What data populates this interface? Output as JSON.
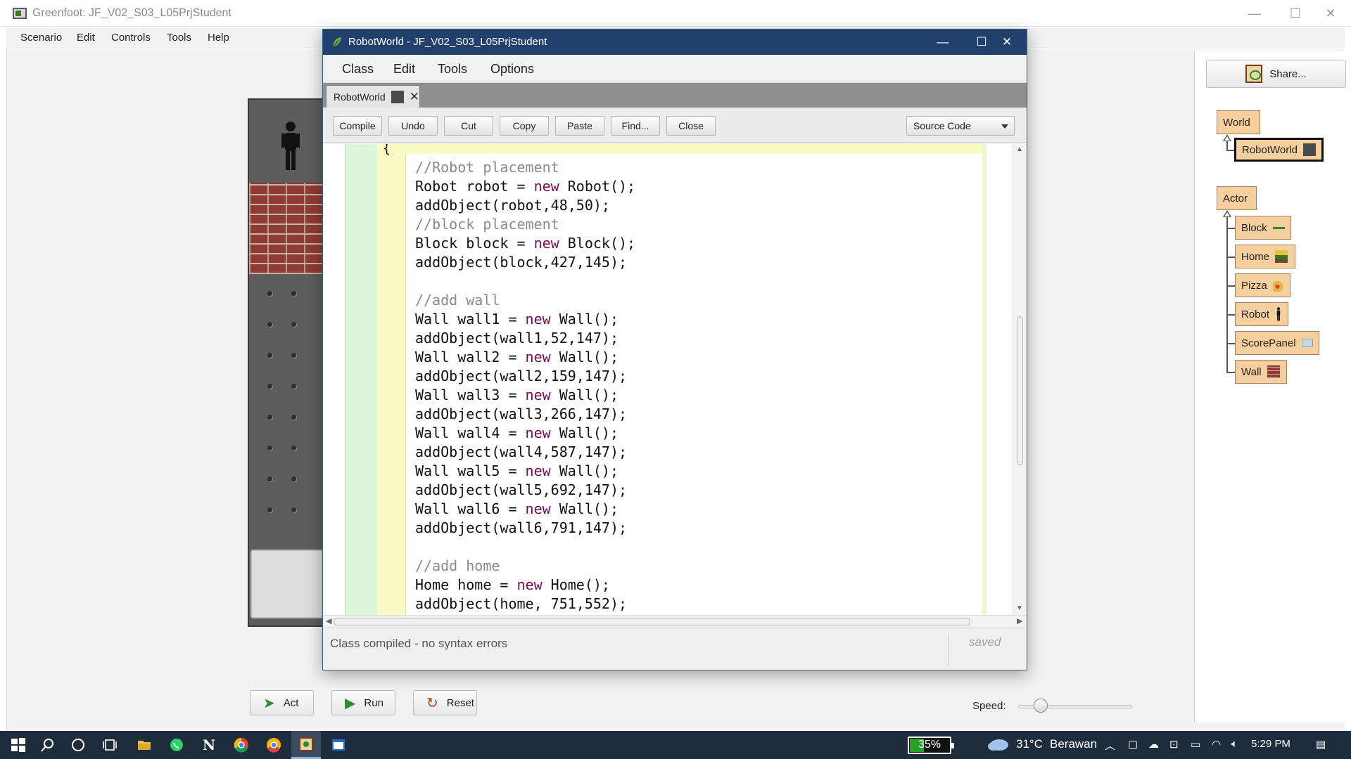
{
  "greenfoot": {
    "title": "Greenfoot: JF_V02_S03_L05PrjStudent",
    "menu": [
      "Scenario",
      "Edit",
      "Controls",
      "Tools",
      "Help"
    ],
    "controls": {
      "act": "Act",
      "run": "Run",
      "reset": "Reset",
      "speed_label": "Speed:",
      "speed_value": 0.2
    },
    "share_label": "Share...",
    "classes": {
      "world": "World",
      "robot_world": "RobotWorld",
      "actor": "Actor",
      "actor_subclasses": [
        "Block",
        "Home",
        "Pizza",
        "Robot",
        "ScorePanel",
        "Wall"
      ]
    }
  },
  "editor": {
    "title": "RobotWorld - JF_V02_S03_L05PrjStudent",
    "menu": [
      "Class",
      "Edit",
      "Tools",
      "Options"
    ],
    "tab_label": "RobotWorld",
    "toolbar": [
      "Compile",
      "Undo",
      "Cut",
      "Copy",
      "Paste",
      "Find...",
      "Close"
    ],
    "view_mode": "Source Code",
    "code_lines": [
      "//Robot placement",
      "Robot robot = new Robot();",
      "addObject(robot,48,50);",
      "//block placement",
      "Block block = new Block();",
      "addObject(block,427,145);",
      "",
      "//add wall",
      "Wall wall1 = new Wall();",
      "addObject(wall1,52,147);",
      "Wall wall2 = new Wall();",
      "addObject(wall2,159,147);",
      "Wall wall3 = new Wall();",
      "addObject(wall3,266,147);",
      "Wall wall4 = new Wall();",
      "addObject(wall4,587,147);",
      "Wall wall5 = new Wall();",
      "addObject(wall5,692,147);",
      "Wall wall6 = new Wall();",
      "addObject(wall6,791,147);",
      "",
      "//add home",
      "Home home = new Home();",
      "addObject(home, 751,552);"
    ],
    "status_message": "Class compiled - no syntax errors",
    "saved_label": "saved"
  },
  "taskbar": {
    "battery": "35%",
    "temperature": "31°C",
    "weather": "Berawan",
    "time": "5:29 PM"
  },
  "colors": {
    "editor_title_bar": "#22406e",
    "class_box": "#f6cf9f",
    "keyword": "#7a0a55",
    "comment": "#8a8a8a",
    "taskbar": "#1f2c3c"
  }
}
